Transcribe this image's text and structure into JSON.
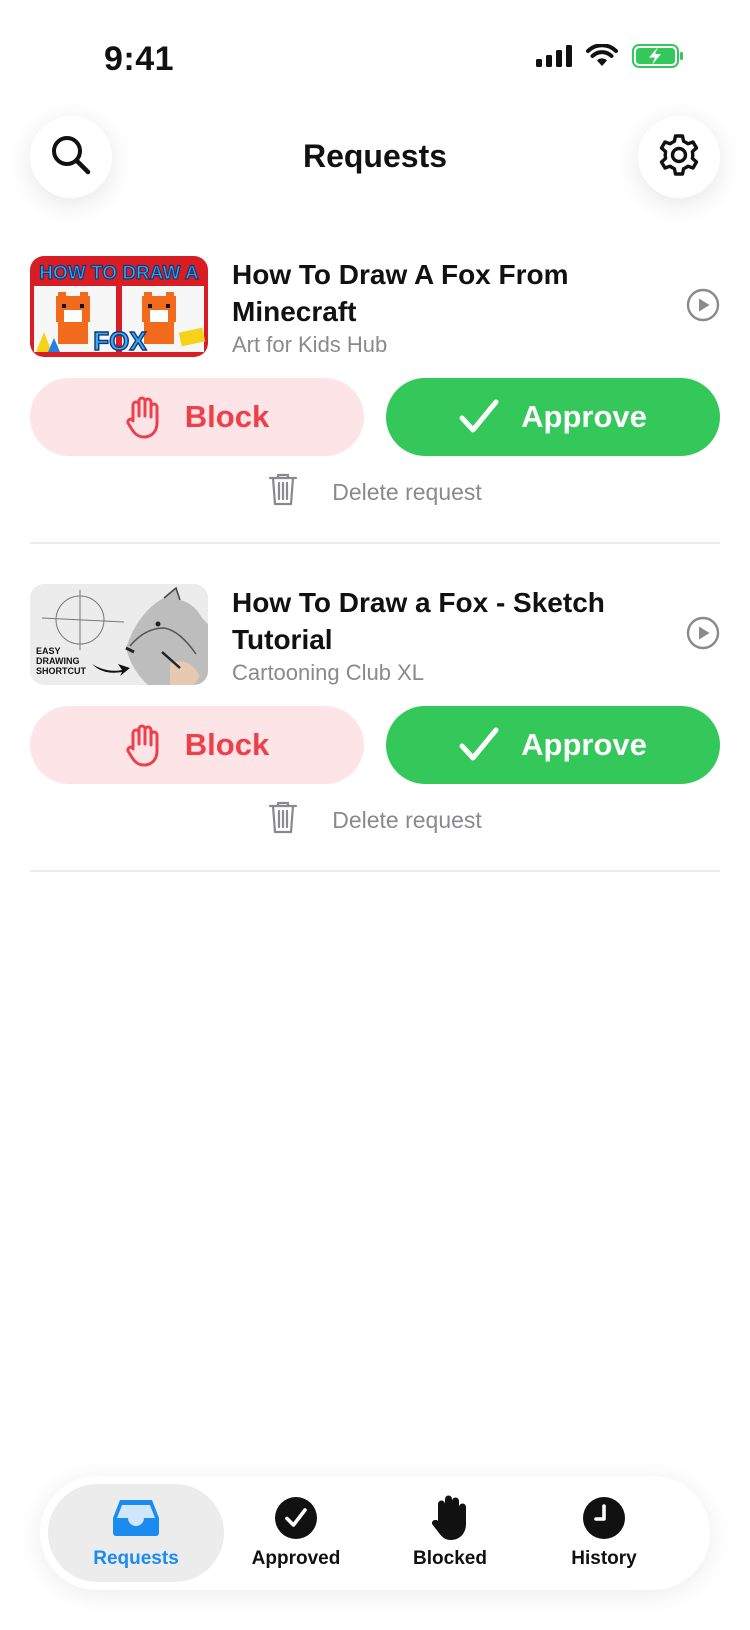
{
  "status_bar": {
    "time": "9:41"
  },
  "header": {
    "title": "Requests",
    "search_icon": "search-icon",
    "settings_icon": "gear-icon"
  },
  "requests": [
    {
      "title": "How To Draw A Fox From Minecraft",
      "channel": "Art for Kids Hub",
      "thumbnail_text": {
        "line1": "HOW TO DRAW A",
        "line2": "FOX"
      },
      "block_label": "Block",
      "approve_label": "Approve",
      "delete_label": "Delete request"
    },
    {
      "title": "How To Draw a Fox - Sketch Tutorial",
      "channel": "Cartooning Club XL",
      "thumbnail_text": {
        "line1": "EASY",
        "line2": "DRAWING",
        "line3": "SHORTCUT"
      },
      "block_label": "Block",
      "approve_label": "Approve",
      "delete_label": "Delete request"
    }
  ],
  "tabs": [
    {
      "label": "Requests",
      "icon": "inbox-tray-icon",
      "active": true
    },
    {
      "label": "Approved",
      "icon": "checkmark-circle-icon",
      "active": false
    },
    {
      "label": "Blocked",
      "icon": "hand-raised-icon",
      "active": false
    },
    {
      "label": "History",
      "icon": "clock-icon",
      "active": false
    }
  ],
  "colors": {
    "approve_green": "#34c75a",
    "block_red": "#ee3f4b",
    "block_bg": "#fde4e6",
    "active_tab_blue": "#1a8cf0",
    "battery_green": "#34c75a"
  }
}
